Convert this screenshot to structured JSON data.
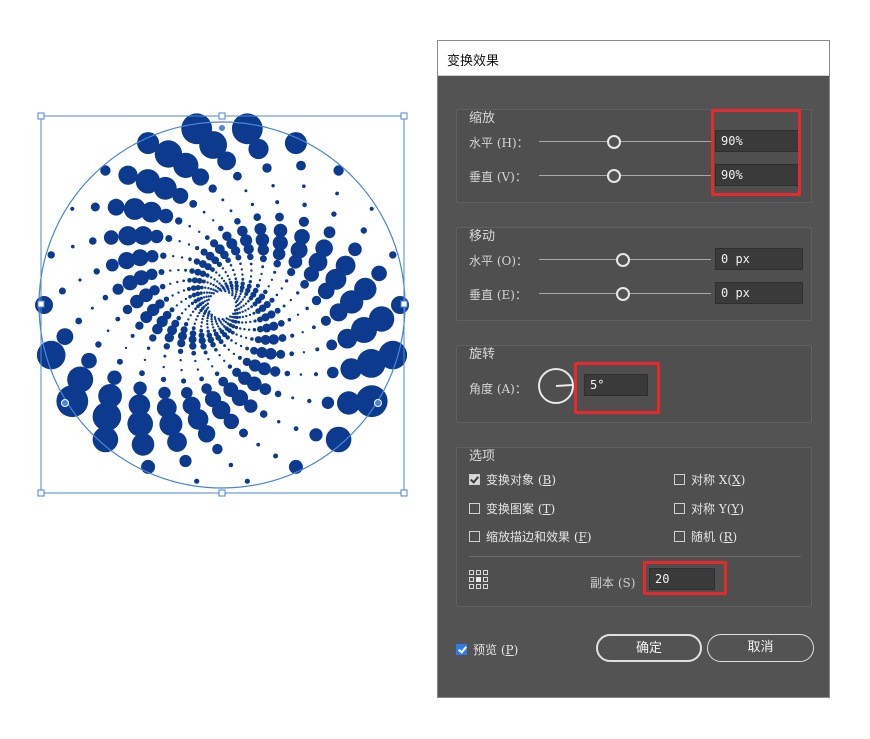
{
  "dialog": {
    "title": "变换效果",
    "scale": {
      "title": "缩放",
      "horizontal_label": "水平 (H)：",
      "horizontal_value": "90%",
      "vertical_label": "垂直 (V)：",
      "vertical_value": "90%"
    },
    "move": {
      "title": "移动",
      "horizontal_label": "水平 (O)：",
      "horizontal_value": "0 px",
      "vertical_label": "垂直 (E)：",
      "vertical_value": "0 px"
    },
    "rotate": {
      "title": "旋转",
      "angle_label": "角度 (A)：",
      "angle_value": "5°"
    },
    "options": {
      "title": "选项",
      "transform_objects": {
        "label": "变换对象 (",
        "key": "B",
        "end": ")",
        "checked": true
      },
      "transform_patterns": {
        "label": "变换图案 (",
        "key": "T",
        "end": ")",
        "checked": false
      },
      "scale_strokes": {
        "label": "缩放描边和效果 (",
        "key": "F",
        "end": ")",
        "checked": false
      },
      "reflect_x": {
        "label": "对称 X(",
        "key": "X",
        "end": ")",
        "checked": false
      },
      "reflect_y": {
        "label": "对称 Y(",
        "key": "Y",
        "end": ")",
        "checked": false
      },
      "random": {
        "label": "随机 (",
        "key": "R",
        "end": ")",
        "checked": false
      },
      "copies_label": "副本 (S)",
      "copies_value": "20"
    },
    "preview": {
      "label": "预览 (",
      "key": "P",
      "end": ")",
      "checked": true
    },
    "ok_label": "确定",
    "cancel_label": "取消"
  },
  "colors": {
    "accent_highlight": "#e8282a",
    "dot_blue": "#0c3a8f",
    "selection": "#4a86d6",
    "checkbox_blue": "#2f7be8"
  }
}
